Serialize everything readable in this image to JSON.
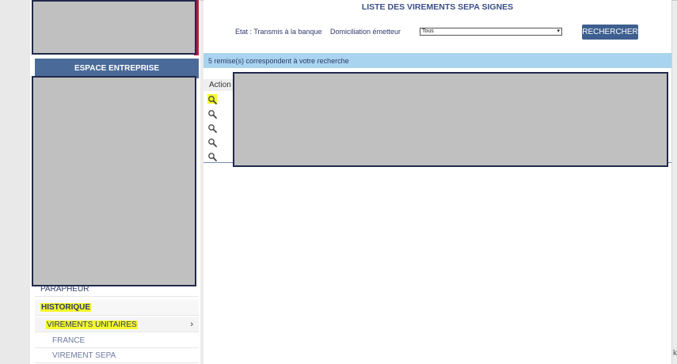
{
  "sidebar": {
    "espace_title": "ESPACE ENTREPRISE",
    "menu": {
      "parapheur": "PARAPHEUR",
      "historique": "HISTORIQUE",
      "virements_unitaires": "VIREMENTS UNITAIRES",
      "france": "FRANCE",
      "virement_sepa": "VIREMENT SEPA"
    },
    "chevron": "›"
  },
  "main": {
    "title": "LISTE DES VIREMENTS SEPA SIGNES",
    "filters": {
      "etat_label": "Etat : Transmis à la banque",
      "domiciliation_label": "Domiciliation émetteur",
      "domiciliation_value": "Tous",
      "search_button": "RECHERCHER"
    },
    "result_text": "5 remise(s) correspondent à votre recherche",
    "table": {
      "column_action": "Action",
      "row_count": 5
    }
  },
  "colors": {
    "accent_blue": "#3e5f8f",
    "banner_blue": "#a9d4ef",
    "highlight": "#f4f82a",
    "brand_red": "#b01c3c",
    "redaction": "#c0c0c0"
  },
  "icons": {
    "row_action": "magnifier-icon",
    "menu_expand": "chevron-right-icon",
    "select_caret": "chevron-down-icon"
  },
  "footer_glyph": "k"
}
